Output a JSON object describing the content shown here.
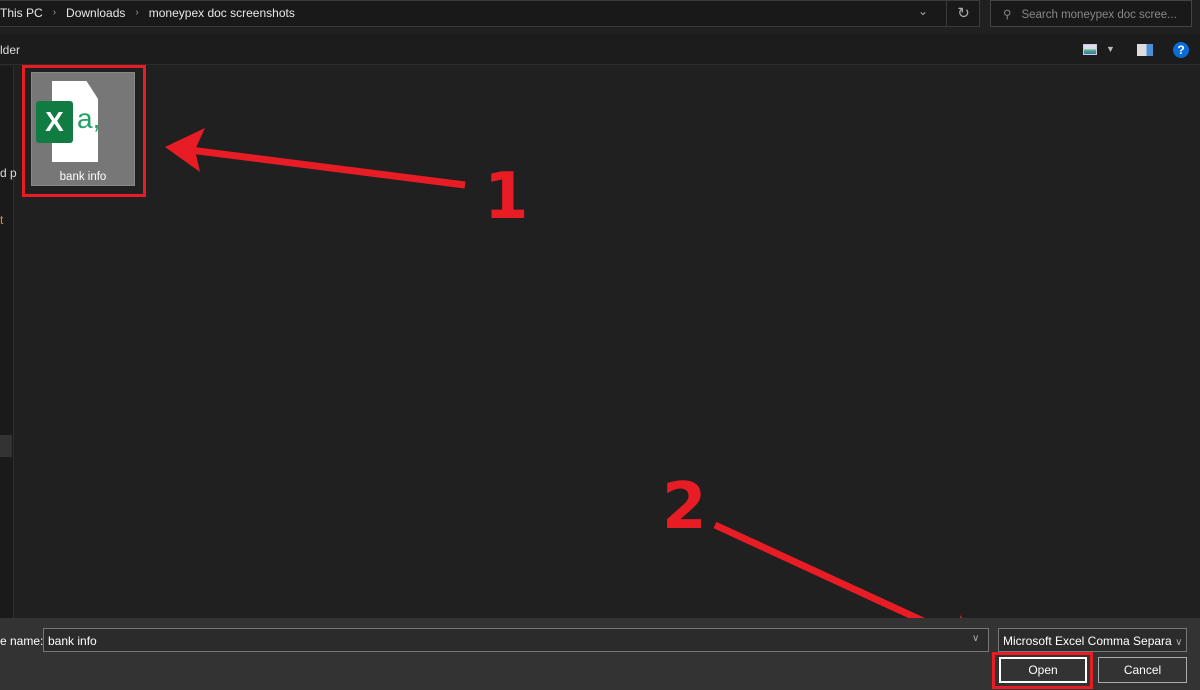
{
  "address_bar": {
    "breadcrumbs": [
      "This PC",
      "Downloads",
      "moneypex doc screenshots"
    ]
  },
  "search": {
    "placeholder": "Search moneypex doc scree..."
  },
  "toolbar": {
    "label": "lder"
  },
  "sidebar": {
    "items": [
      "d p",
      "t"
    ]
  },
  "files": [
    {
      "name": "bank info",
      "icon": "excel-csv-icon"
    }
  ],
  "bottom": {
    "file_name_label": "e name:",
    "file_name_value": "bank info",
    "file_type": "Microsoft Excel Comma Separa",
    "open_label": "Open",
    "cancel_label": "Cancel"
  },
  "annotations": {
    "step1": "1",
    "step2": "2",
    "color": "#e81c24"
  }
}
